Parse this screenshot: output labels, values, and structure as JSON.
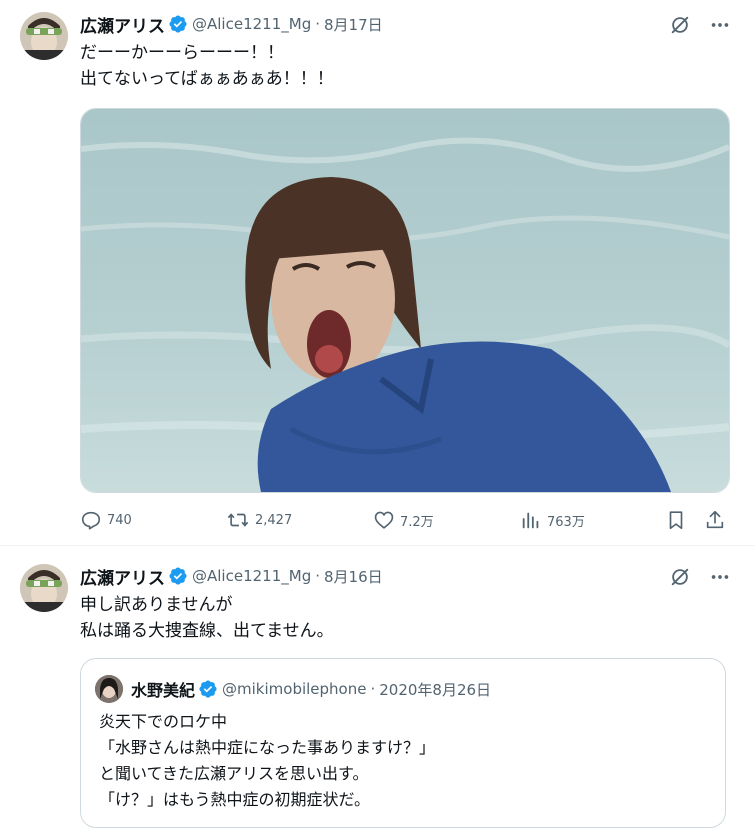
{
  "colors": {
    "accent": "#1d9bf0",
    "text": "#0f1419",
    "muted": "#536471",
    "border": "#cfd9de"
  },
  "tweet1": {
    "author_name": "広瀬アリス",
    "verified_icon": "verified-badge-icon",
    "handle": "@Alice1211_Mg",
    "separator": "·",
    "date": "8月17日",
    "lines": [
      "だーーかーーらーーー！！",
      "出てないってばぁぁあぁあ！！！"
    ],
    "media_description_icon": "photo",
    "actions": {
      "replies": "740",
      "retweets": "2,427",
      "likes": "7.2万",
      "views": "763万"
    }
  },
  "tweet2": {
    "author_name": "広瀬アリス",
    "handle": "@Alice1211_Mg",
    "separator": "·",
    "date": "8月16日",
    "lines": [
      "申し訳ありませんが",
      "私は踊る大捜査線、出てません。"
    ],
    "quote": {
      "author_name": "水野美紀",
      "handle": "@mikimobilephone",
      "separator": "·",
      "date": "2020年8月26日",
      "lines": [
        "炎天下でのロケ中",
        "「水野さんは熱中症になった事ありますけ？」",
        "と聞いてきた広瀬アリスを思い出す。",
        "「け？」はもう熱中症の初期症状だ。"
      ]
    }
  }
}
